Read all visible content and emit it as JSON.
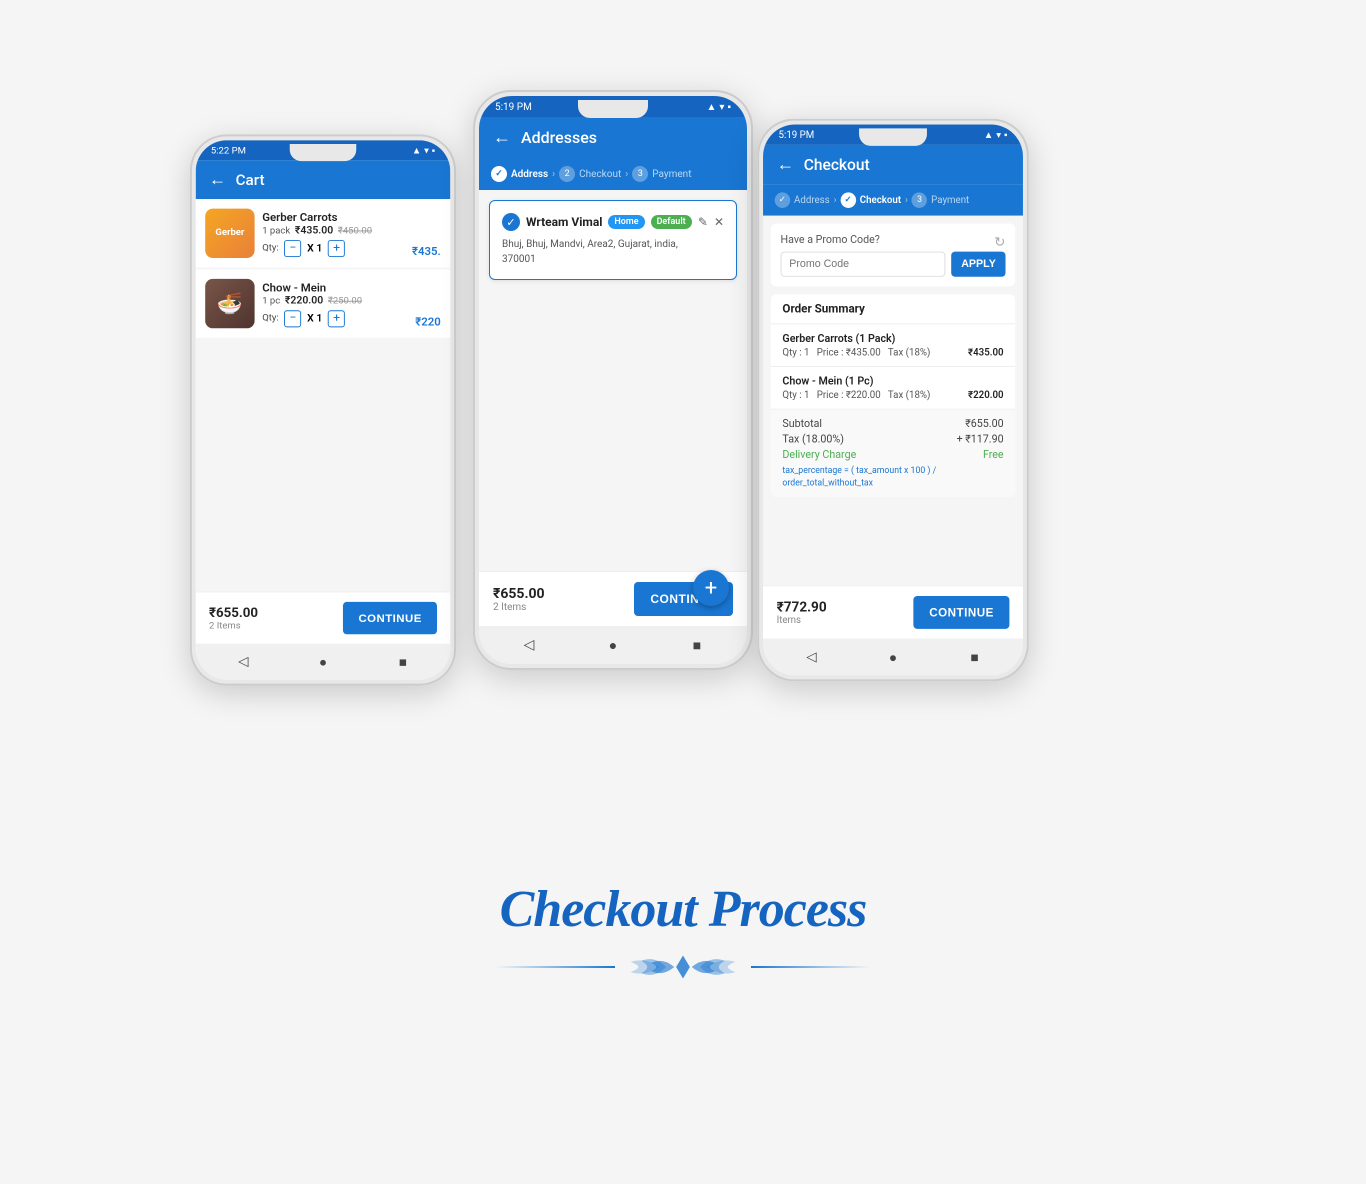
{
  "page": {
    "title": "Checkout Process",
    "background": "#f5f5f5"
  },
  "phone1": {
    "status_time": "5:22 PM",
    "app_bar_title": "Cart",
    "items": [
      {
        "name": "Gerber Carrots",
        "pack": "1 pack",
        "price": "₹435.00",
        "original_price": "₹450.00",
        "qty": "1",
        "display_price": "₹435."
      },
      {
        "name": "Chow - Mein",
        "pack": "1 pc",
        "price": "₹220.00",
        "original_price": "₹250.00",
        "qty": "1",
        "display_price": "₹220"
      }
    ],
    "total": "₹655.00",
    "items_count": "2 Items",
    "continue_label": "CONTINUE"
  },
  "phone2": {
    "status_time": "5:19 PM",
    "app_bar_title": "Addresses",
    "steps": [
      {
        "label": "Address",
        "active": true
      },
      {
        "label": "Checkout",
        "active": false
      },
      {
        "label": "Payment",
        "active": false
      }
    ],
    "address": {
      "name": "Wrteam Vimal",
      "badge_home": "Home",
      "badge_default": "Default",
      "text": "Bhuj, Bhuj, Mandvi, Area2, Gujarat, india,",
      "pincode": "370001"
    },
    "total": "₹655.00",
    "items_count": "2 Items",
    "continue_label": "CONTINUE",
    "fab_icon": "+"
  },
  "phone3": {
    "status_time": "5:19 PM",
    "app_bar_title": "Checkout",
    "steps": [
      {
        "label": "Address",
        "active": false
      },
      {
        "label": "Checkout",
        "active": true
      },
      {
        "label": "Payment",
        "active": false
      }
    ],
    "promo": {
      "label": "Have a Promo Code?",
      "placeholder": "Promo Code",
      "apply_label": "APPLY"
    },
    "order_summary_title": "Order Summary",
    "order_items": [
      {
        "name": "Gerber Carrots (1 Pack)",
        "qty": "Qty : 1",
        "price_label": "Price : ₹435.00",
        "tax_label": "Tax (18%)",
        "total": "₹435.00"
      },
      {
        "name": "Chow - Mein (1 Pc)",
        "qty": "Qty : 1",
        "price_label": "Price : ₹220.00",
        "tax_label": "Tax (18%)",
        "total": "₹220.00"
      }
    ],
    "totals": {
      "subtotal_label": "Subtotal",
      "subtotal_value": "₹655.00",
      "tax_label": "Tax (18.00%)",
      "tax_value": "+ ₹117.90",
      "delivery_label": "Delivery Charge",
      "delivery_value": "Free",
      "tax_note": "tax_percentage = ( tax_amount x 100 ) / order_total_without_tax"
    },
    "total": "₹772.90",
    "items_count": "Items",
    "continue_label": "CONTINUE"
  },
  "ornament": {
    "left_line": true,
    "right_line": true,
    "center_symbol": "❋"
  }
}
